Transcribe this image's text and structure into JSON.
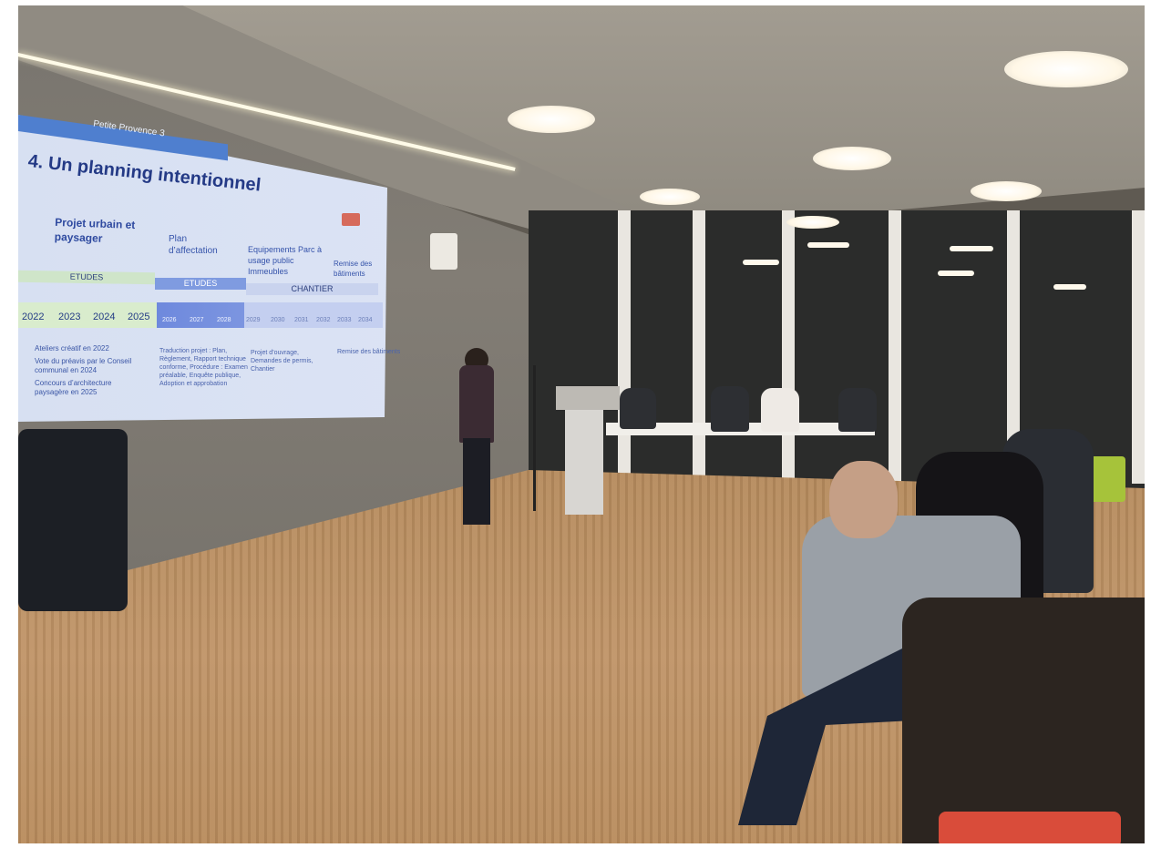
{
  "slide": {
    "subtitle": "Petite Provence 3",
    "title": "4. Un planning intentionnel",
    "columns": [
      {
        "text": "Projet urbain et paysager"
      },
      {
        "text": "Plan d’affectation"
      },
      {
        "text": "Equipements Parc à usage public Immeubles"
      },
      {
        "text": "Remise des bâtiments"
      }
    ],
    "phases": [
      "ETUDES",
      "ETUDES",
      "CHANTIER"
    ],
    "years": [
      "2022",
      "2023",
      "2024",
      "2025",
      "2026",
      "2027",
      "2028",
      "2029",
      "2030",
      "2031",
      "2032",
      "2033",
      "2034"
    ],
    "bullets": [
      "Ateliers créatif en 2022",
      "Vote du préavis par le Conseil communal en 2024",
      "Concours d’architecture paysagère en 2025"
    ],
    "details": [
      "Traduction projet : Plan, Règlement, Rapport technique conforme, Procédure : Examen préalable, Enquête publique, Adoption et approbation",
      "Projet d’ouvrage, Demandes de permis, Chantier",
      "Remise des bâtiments"
    ]
  },
  "colors": {
    "slide_text": "#2a3f8a",
    "slide_band": "#4f7fcf",
    "floor": "#b88b5c",
    "wall": "#7f7a72"
  }
}
